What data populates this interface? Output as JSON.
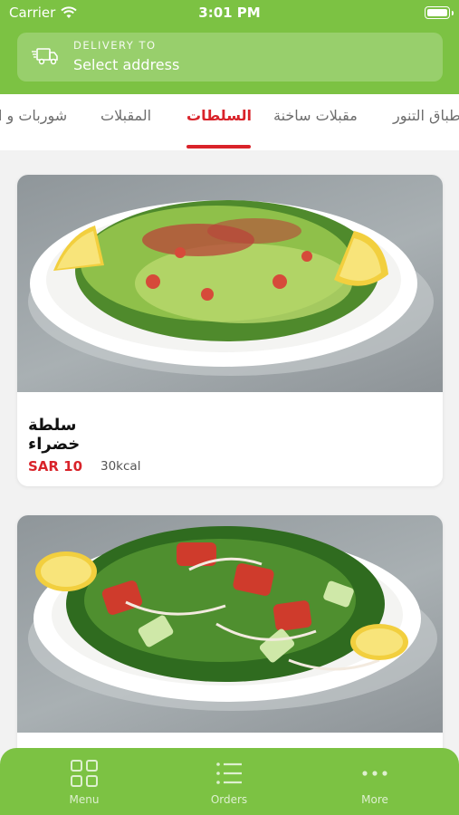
{
  "status_bar": {
    "carrier": "Carrier",
    "time": "3:01 PM"
  },
  "delivery": {
    "label": "DELIVERY TO",
    "value": "Select address"
  },
  "categories": [
    {
      "label": "أطباق التنور",
      "active": false
    },
    {
      "label": "مقبلات ساخنة",
      "active": false
    },
    {
      "label": "السلطات",
      "active": true
    },
    {
      "label": "المقبلات",
      "active": false
    },
    {
      "label": "شوربات و ا",
      "active": false
    }
  ],
  "items": [
    {
      "name": "سلطة خضراء",
      "price": "SAR 10",
      "kcal": "30kcal"
    },
    {
      "name": "",
      "price": "",
      "kcal": ""
    }
  ],
  "bottom_nav": [
    {
      "label": "Menu",
      "icon": "grid-icon"
    },
    {
      "label": "Orders",
      "icon": "list-icon"
    },
    {
      "label": "More",
      "icon": "more-dots-icon"
    }
  ],
  "colors": {
    "brand_green": "#7cc243",
    "accent_red": "#d9232a"
  }
}
